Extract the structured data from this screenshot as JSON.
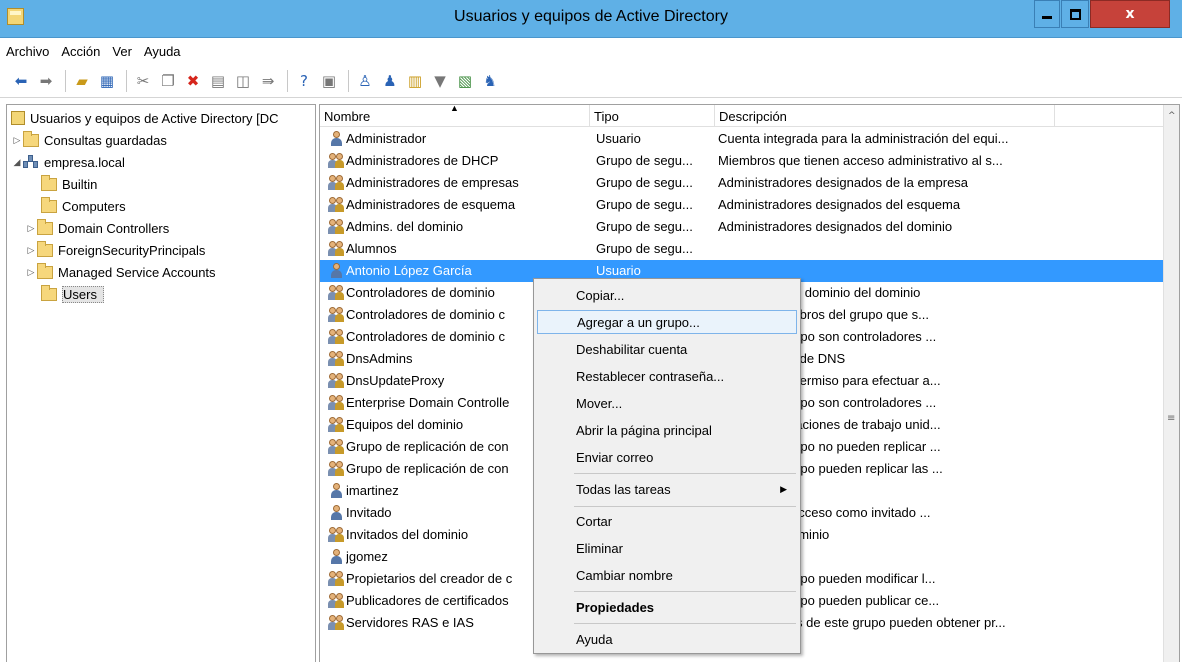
{
  "window": {
    "title": "Usuarios y equipos de Active Directory",
    "close_label": "x"
  },
  "menu": [
    "Archivo",
    "Acción",
    "Ver",
    "Ayuda"
  ],
  "toolbar": {
    "icons": [
      "back-arrow-icon",
      "forward-arrow-icon",
      "up-folder-icon",
      "show-tree-icon",
      "cut-icon",
      "copy-icon",
      "delete-icon",
      "properties-icon",
      "refresh-icon",
      "export-list-icon",
      "help-icon",
      "console-icon",
      "new-user-icon",
      "new-group-icon",
      "new-ou-icon",
      "filter-icon",
      "add-to-group-icon",
      "delegate-icon"
    ]
  },
  "tree": {
    "root": "Usuarios y equipos de Active Directory [DC",
    "saved_queries": "Consultas guardadas",
    "domain": "empresa.local",
    "items": [
      "Builtin",
      "Computers",
      "Domain Controllers",
      "ForeignSecurityPrincipals",
      "Managed Service Accounts",
      "Users"
    ]
  },
  "list": {
    "columns": {
      "name": "Nombre",
      "type": "Tipo",
      "description": "Descripción"
    },
    "rows": [
      {
        "name": "Administrador",
        "type": "Usuario",
        "description": "Cuenta integrada para la administración del equi...",
        "kind": "user"
      },
      {
        "name": "Administradores de DHCP",
        "type": "Grupo de segu...",
        "description": "Miembros que tienen acceso administrativo al s...",
        "kind": "group"
      },
      {
        "name": "Administradores de empresas",
        "type": "Grupo de segu...",
        "description": "Administradores designados de la empresa",
        "kind": "group"
      },
      {
        "name": "Administradores de esquema",
        "type": "Grupo de segu...",
        "description": "Administradores designados del esquema",
        "kind": "group"
      },
      {
        "name": "Admins. del dominio",
        "type": "Grupo de segu...",
        "description": "Administradores designados del dominio",
        "kind": "group"
      },
      {
        "name": "Alumnos",
        "type": "Grupo de segu...",
        "description": "",
        "kind": "group"
      },
      {
        "name": "Antonio López García",
        "type": "Usuario",
        "description": "",
        "kind": "user",
        "selected": true
      },
      {
        "name": "Controladores de dominio",
        "type": "",
        "description": "ntroladores de dominio del dominio",
        "kind": "group"
      },
      {
        "name": "Controladores de dominio c",
        "type": "",
        "description": "onar los miembros del grupo que s...",
        "kind": "group"
      },
      {
        "name": "Controladores de dominio c",
        "type": "",
        "description": "os de este grupo son controladores ...",
        "kind": "group"
      },
      {
        "name": "DnsAdmins",
        "type": "",
        "description": "ministradores de DNS",
        "kind": "group"
      },
      {
        "name": "DnsUpdateProxy",
        "type": "",
        "description": "s que tienen permiso para efectuar a...",
        "kind": "group"
      },
      {
        "name": "Enterprise Domain Controlle",
        "type": "",
        "description": "os de este grupo son controladores ...",
        "kind": "group"
      },
      {
        "name": "Equipos del dominio",
        "type": "",
        "description": "rvidores y estaciones de trabajo unid...",
        "kind": "group"
      },
      {
        "name": "Grupo de replicación de con",
        "type": "",
        "description": "os de este grupo no pueden replicar ...",
        "kind": "group"
      },
      {
        "name": "Grupo de replicación de con",
        "type": "",
        "description": "os de este grupo pueden replicar las ...",
        "kind": "group"
      },
      {
        "name": "imartinez",
        "type": "",
        "description": "",
        "kind": "user"
      },
      {
        "name": "Invitado",
        "type": "",
        "description": "rada para el acceso como invitado ...",
        "kind": "user"
      },
      {
        "name": "Invitados del dominio",
        "type": "",
        "description": "vitados del dominio",
        "kind": "group"
      },
      {
        "name": "jgomez",
        "type": "",
        "description": "",
        "kind": "user"
      },
      {
        "name": "Propietarios del creador de c",
        "type": "",
        "description": "os de este grupo pueden modificar l...",
        "kind": "group"
      },
      {
        "name": "Publicadores de certificados",
        "type": "",
        "description": "os de este grupo pueden publicar ce...",
        "kind": "group"
      },
      {
        "name": "Servidores RAS e IAS",
        "type": "Grupo de segu...",
        "description": "Los servidores de este grupo pueden obtener pr...",
        "kind": "group"
      }
    ]
  },
  "context_menu": {
    "items": [
      {
        "label": "Copiar..."
      },
      {
        "label": "Agregar a un grupo...",
        "highlighted": true
      },
      {
        "label": "Deshabilitar cuenta"
      },
      {
        "label": "Restablecer contraseña..."
      },
      {
        "label": "Mover..."
      },
      {
        "label": "Abrir la página principal"
      },
      {
        "label": "Enviar correo"
      },
      {
        "label": "Todas las tareas",
        "submenu": true
      },
      {
        "label": "Cortar"
      },
      {
        "label": "Eliminar"
      },
      {
        "label": "Cambiar nombre"
      },
      {
        "label": "Propiedades",
        "bold": true
      },
      {
        "label": "Ayuda"
      }
    ]
  },
  "colors": {
    "titlebar": "#5fb0e6",
    "selection": "#3399ff",
    "close": "#c6423a"
  }
}
